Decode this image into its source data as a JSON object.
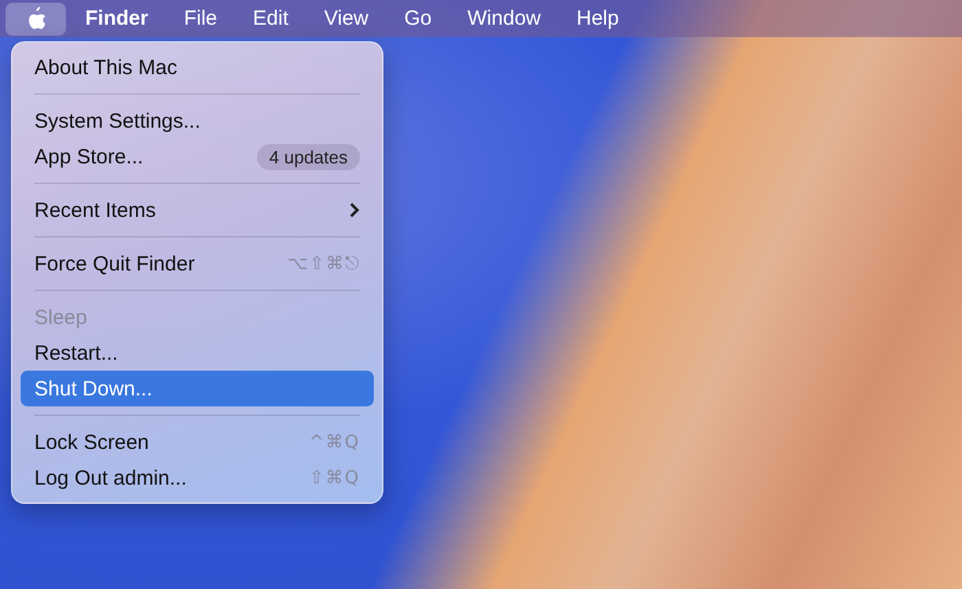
{
  "menu_bar": [
    {
      "kind": "apple",
      "selected": true
    },
    {
      "kind": "app",
      "label": "Finder",
      "selected": false
    },
    {
      "kind": "menu",
      "label": "File",
      "selected": false
    },
    {
      "kind": "menu",
      "label": "Edit",
      "selected": false
    },
    {
      "kind": "menu",
      "label": "View",
      "selected": false
    },
    {
      "kind": "menu",
      "label": "Go",
      "selected": false
    },
    {
      "kind": "menu",
      "label": "Window",
      "selected": false
    },
    {
      "kind": "menu",
      "label": "Help",
      "selected": false
    }
  ],
  "apple_menu": {
    "items": [
      {
        "kind": "item",
        "label": "About This Mac",
        "selected": false,
        "disabled": false,
        "submenu": false
      },
      {
        "kind": "separator"
      },
      {
        "kind": "item",
        "label": "System Settings...",
        "selected": false,
        "disabled": false,
        "submenu": false
      },
      {
        "kind": "item",
        "label": "App Store...",
        "badge": "4 updates",
        "selected": false,
        "disabled": false,
        "submenu": false
      },
      {
        "kind": "separator"
      },
      {
        "kind": "item",
        "label": "Recent Items",
        "selected": false,
        "disabled": false,
        "submenu": true
      },
      {
        "kind": "separator"
      },
      {
        "kind": "item",
        "label": "Force Quit Finder",
        "shortcut": "⌥⇧⌘⎋",
        "selected": false,
        "disabled": false,
        "submenu": false
      },
      {
        "kind": "separator"
      },
      {
        "kind": "item",
        "label": "Sleep",
        "selected": false,
        "disabled": true,
        "submenu": false
      },
      {
        "kind": "item",
        "label": "Restart...",
        "selected": false,
        "disabled": false,
        "submenu": false
      },
      {
        "kind": "item",
        "label": "Shut Down...",
        "selected": true,
        "disabled": false,
        "submenu": false
      },
      {
        "kind": "separator"
      },
      {
        "kind": "item",
        "label": "Lock Screen",
        "shortcut": "^⌘Q",
        "selected": false,
        "disabled": false,
        "submenu": false
      },
      {
        "kind": "item",
        "label": "Log Out admin...",
        "shortcut": "⇧⌘Q",
        "selected": false,
        "disabled": false,
        "submenu": false
      }
    ]
  }
}
